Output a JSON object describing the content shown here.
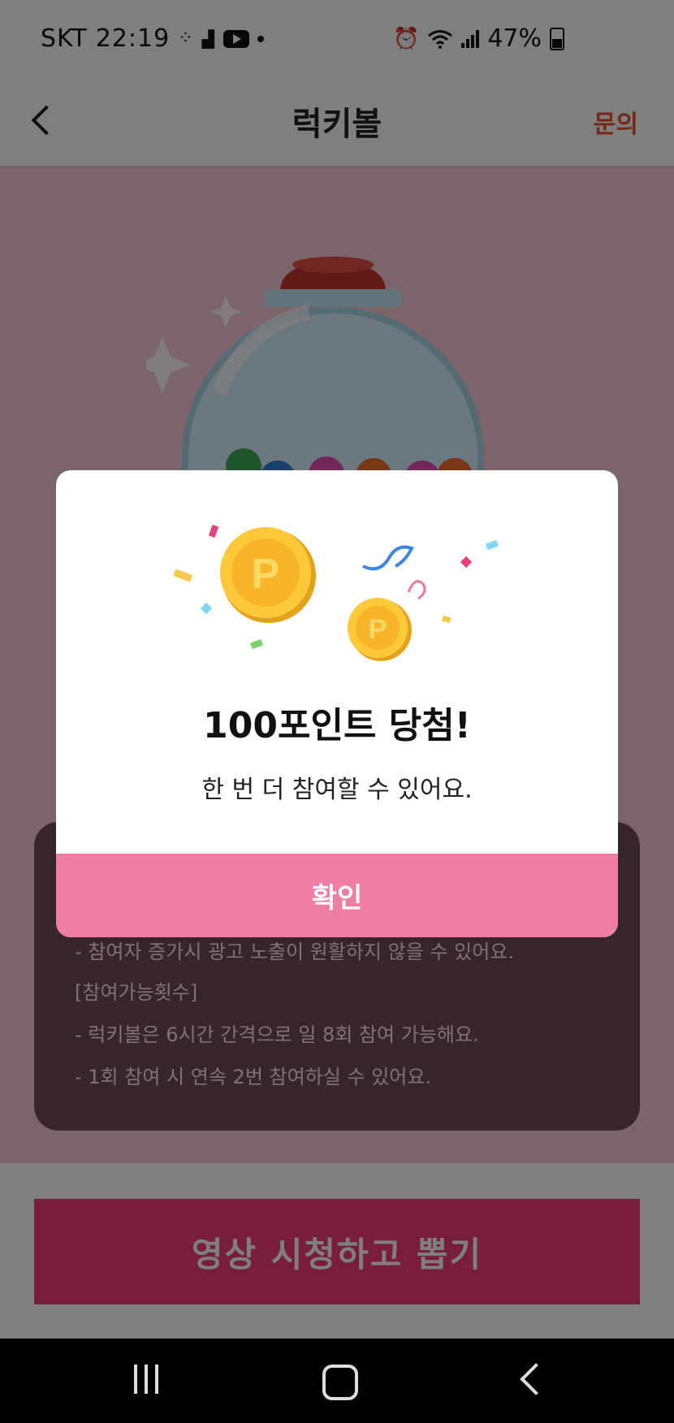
{
  "status_bar": {
    "carrier": "SKT",
    "time": "22:19",
    "battery": "47%",
    "icons": [
      "grid-icon",
      "image-icon",
      "youtube-icon",
      "dot-icon",
      "alarm-icon",
      "wifi-icon",
      "signal-icon",
      "battery-icon"
    ]
  },
  "header": {
    "title": "럭키볼",
    "inquiry_label": "문의",
    "accent_color": "#e85030"
  },
  "info_card": {
    "lines": [
      "- 참여자 증가시 광고 노출이 원활하지 않을 수 있어요.",
      "[참여가능횟수]",
      "- 럭키볼은 6시간 간격으로 일 8회 참여 가능해요.",
      "- 1회 참여 시 연속 2번 참여하실 수 있어요."
    ]
  },
  "cta": {
    "label": "영상 시청하고 뽑기",
    "color": "#f23a78"
  },
  "dialog": {
    "title": "100포인트 당첨!",
    "message": "한 번 더 참여할 수 있어요.",
    "confirm_label": "확인",
    "confirm_color": "#ee7ea3",
    "coin_glyph": "P"
  },
  "nav_bar": {
    "items": [
      "recents-icon",
      "home-icon",
      "back-icon"
    ]
  }
}
